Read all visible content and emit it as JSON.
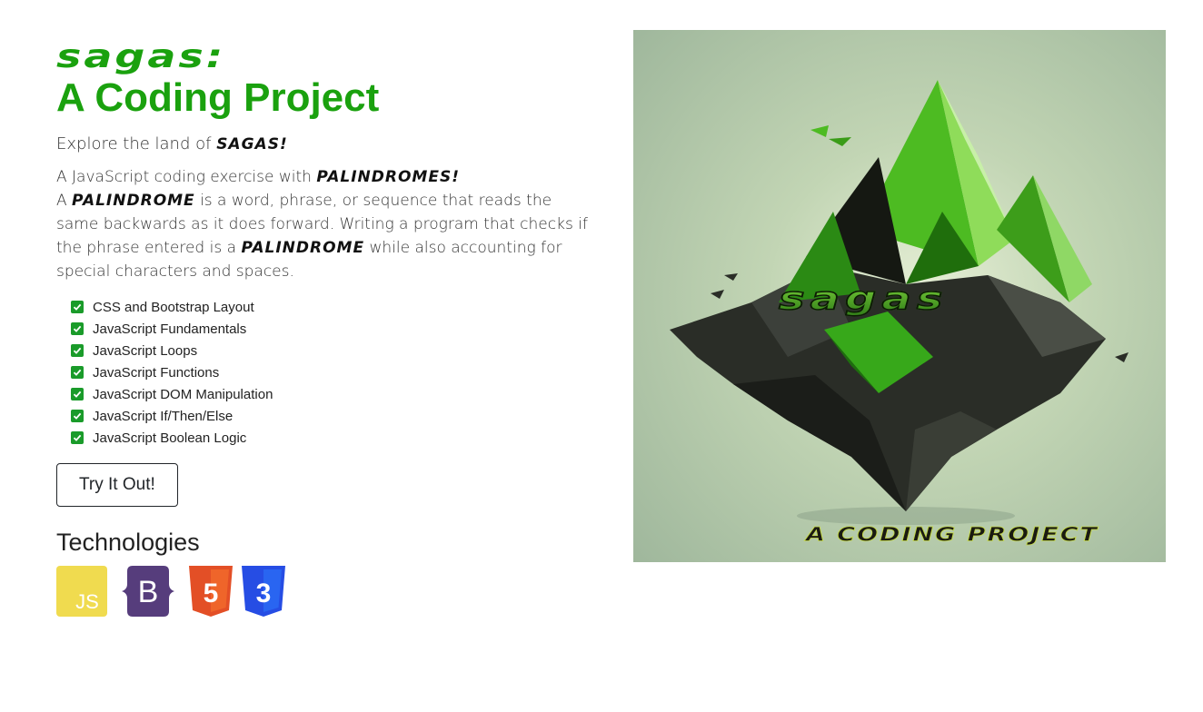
{
  "header": {
    "brand": "sagas:",
    "title": "A Coding Project"
  },
  "intro": {
    "explore_prefix": "Explore the land of ",
    "explore_brand": "sagas!",
    "line1_prefix": "A JavaScript coding exercise with ",
    "line1_stylized": "palindromes!",
    "line2_prefix": "A ",
    "line2_stylized": "palindrome",
    "line2_middle": " is a word, phrase, or sequence that reads the same backwards as it does forward. Writing a program that checks if the phrase entered is a ",
    "line2_stylized_2": "palindrome",
    "line2_suffix": " while also accounting for special characters and spaces."
  },
  "skills": [
    "CSS and Bootstrap Layout",
    "JavaScript Fundamentals",
    "JavaScript Loops",
    "JavaScript Functions",
    "JavaScript DOM Manipulation",
    "JavaScript If/Then/Else",
    "JavaScript Boolean Logic"
  ],
  "cta": {
    "label": "Try It Out!"
  },
  "technologies": {
    "heading": "Technologies",
    "icons": [
      {
        "icon": "javascript-icon",
        "label": "JS",
        "color": "#f0db4f"
      },
      {
        "icon": "bootstrap-icon",
        "label": "B",
        "color": "#563d7c"
      },
      {
        "icon": "html5-icon",
        "label": "5",
        "color": "#e34f26"
      },
      {
        "icon": "css3-icon",
        "label": "3",
        "color": "#264de4"
      }
    ]
  },
  "hero": {
    "logo_text": "sagas",
    "tagline": "a coding project"
  },
  "colors": {
    "brand_green": "#1aa10e",
    "check_green": "#1a9b2a"
  }
}
